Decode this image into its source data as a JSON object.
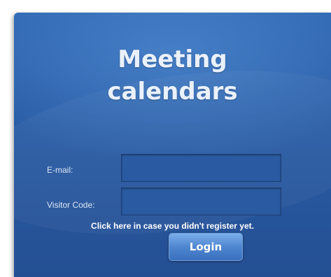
{
  "title": {
    "line1": "Meeting",
    "line2": "calendars"
  },
  "form": {
    "email_label": "E-mail:",
    "email_value": "",
    "code_label": "Visitor Code:",
    "code_value": "",
    "register_link": "Click here in case you didn't register yet.",
    "login_label": "Login"
  },
  "colors": {
    "panel_bg": "#2a5da6",
    "field_bg": "#2a5aa1",
    "button_bg": "#4f86d0",
    "text": "#ffffff"
  }
}
